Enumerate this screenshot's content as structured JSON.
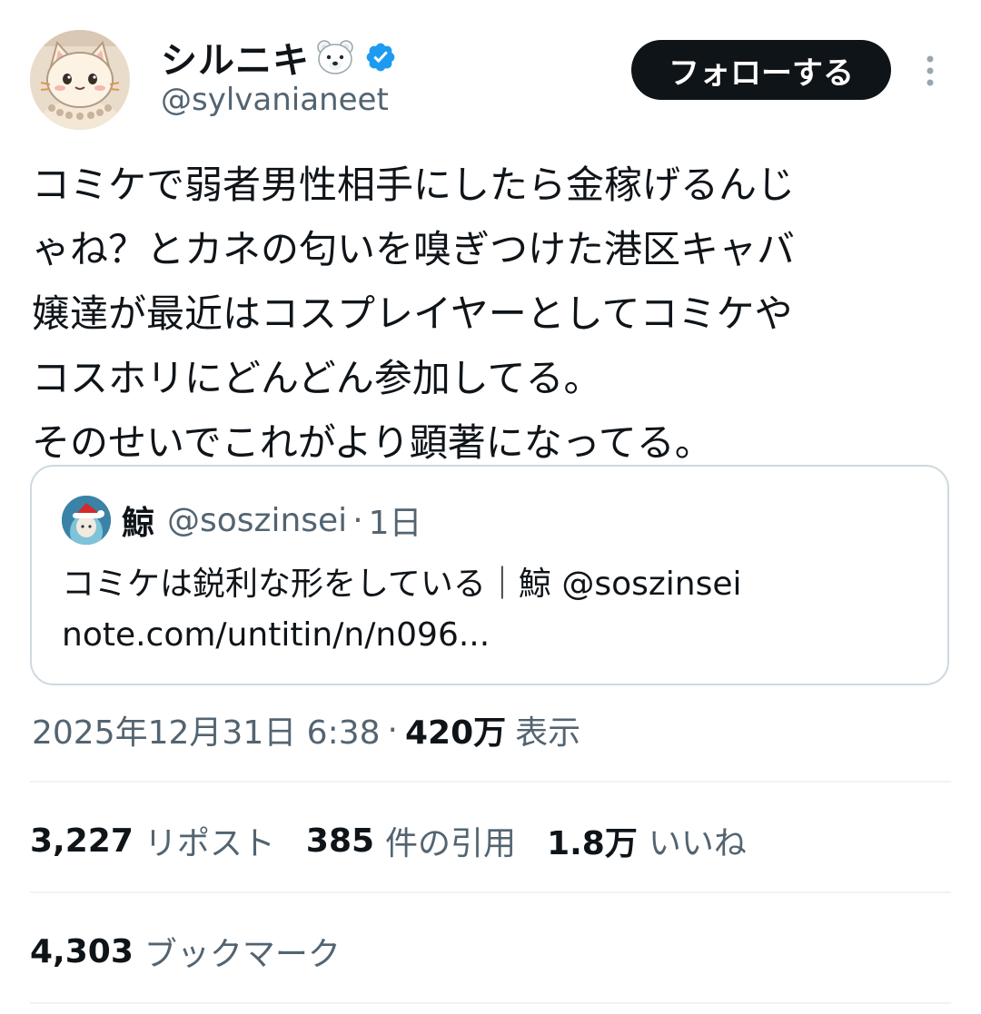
{
  "author": {
    "display_name": "シルニキ",
    "name_emoji": "polar-bear-face",
    "verified_icon": "verified-badge-icon",
    "handle": "@sylvanianeet",
    "follow_label": "フォローする"
  },
  "tweet": {
    "text_lines": [
      "コミケで弱者男性相手にしたら金稼げるんじ",
      "ゃね？とカネの匂いを嗅ぎつけた港区キャバ",
      "嬢達が最近はコスプレイヤーとしてコミケや",
      "コスホリにどんどん参加してる。",
      "そのせいでこれがより顕著になってる。"
    ]
  },
  "quote": {
    "name": "鯨",
    "handle": "@soszinsei",
    "dot": "·",
    "time": "1日",
    "text": "コミケは鋭利な形をしている｜鯨 @soszinsei",
    "link": "note.com/untitin/n/n096..."
  },
  "meta": {
    "timestamp": "2025年12月31日 6:38",
    "dot": "·",
    "views": "420万",
    "views_label": "表示"
  },
  "stats": {
    "reposts": "3,227",
    "reposts_label": "リポスト",
    "quotes": "385",
    "quotes_label": "件の引用",
    "likes": "1.8万",
    "likes_label": "いいね",
    "bookmarks": "4,303",
    "bookmarks_label": "ブックマーク"
  },
  "colors": {
    "text": "#0f1419",
    "secondary": "#536471",
    "border": "#cfd9de",
    "verified": "#1d9bf0"
  }
}
